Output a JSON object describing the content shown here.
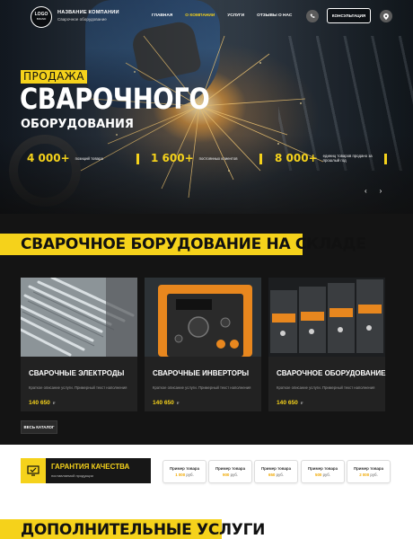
{
  "header": {
    "logo_line1": "LOGO",
    "logo_line2": "BRAND",
    "company_name": "НАЗВАНИЕ КОМПАНИИ",
    "company_sub": "Сварочное оборудование",
    "nav": [
      "Главная",
      "О компании",
      "Услуги",
      "Отзывы о нас"
    ],
    "active_nav": 1,
    "consult_label": "Консультация",
    "phone_icon": "phone-icon",
    "location_icon": "location-pin-icon"
  },
  "hero": {
    "line1": "ПРОДАЖА",
    "line2": "СВАРОЧНОГО",
    "line3": "ОБОРУДОВАНИЯ",
    "stats": [
      {
        "value": "4 000+",
        "label": "позиций товара"
      },
      {
        "value": "1 600+",
        "label": "постоянных клиентов"
      },
      {
        "value": "8 000+",
        "label": "единиц товаров продано за прошлый год"
      }
    ],
    "prev_label": "‹",
    "next_label": "›"
  },
  "catalog_section": {
    "title": "СВАРОЧНОЕ БОРУДОВАНИЕ НА СКЛАДЕ",
    "cards": [
      {
        "title": "Сварочные электроды",
        "desc": "Краткое описание услуги. Примерный текст наполнения",
        "price": "140 650",
        "currency": "₽"
      },
      {
        "title": "Сварочные инверторы",
        "desc": "Краткое описание услуги. Примерный текст наполнения",
        "price": "140 650",
        "currency": "₽"
      },
      {
        "title": "Сварочное оборудование",
        "desc": "Краткое описание услуги. Примерный текст наполнения",
        "price": "140 650",
        "currency": "₽"
      }
    ],
    "all_catalog": "Весь каталог"
  },
  "guarantee": {
    "title": "ГАРАНТИЯ КАЧЕСТВА",
    "subtitle": "поставляемой продукции",
    "tiles": [
      {
        "name": "Пример товара",
        "price": "1 000",
        "unit": "руб."
      },
      {
        "name": "Пример товара",
        "price": "900",
        "unit": "руб."
      },
      {
        "name": "Пример товара",
        "price": "650",
        "unit": "руб."
      },
      {
        "name": "Пример товара",
        "price": "500",
        "unit": "руб."
      },
      {
        "name": "Пример товара",
        "price": "2 000",
        "unit": "руб."
      }
    ]
  },
  "services_section": {
    "title": "ДОПОЛНИТЕЛЬНЫЕ УСЛУГИ"
  },
  "colors": {
    "accent": "#f5d21b",
    "background": "#141414",
    "card": "#222222"
  }
}
